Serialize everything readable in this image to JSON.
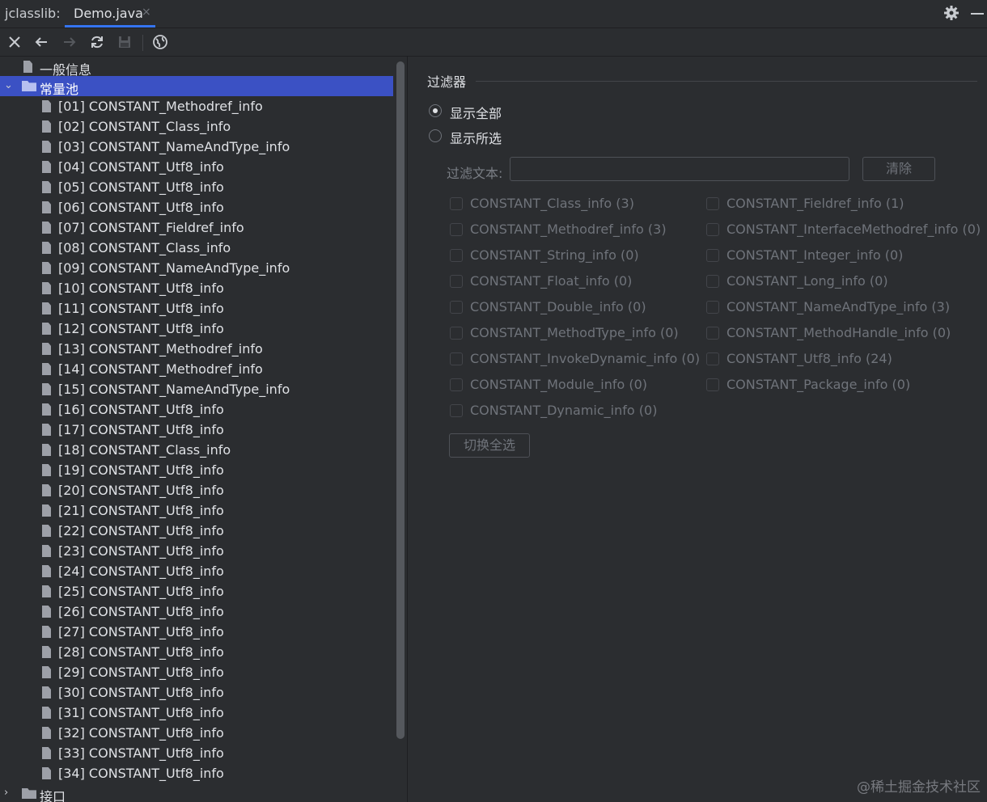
{
  "titlebar": {
    "app_label": "jclasslib:",
    "tab_label": "Demo.java",
    "tab_close": "×",
    "settings_icon": "gear-icon",
    "minimize_icon": "minimize-icon"
  },
  "toolbar": {
    "icons": [
      "close-icon",
      "back-arrow-icon",
      "forward-arrow-icon",
      "refresh-icon",
      "save-icon",
      "browser-icon"
    ]
  },
  "tree": {
    "general_info": "一般信息",
    "constant_pool": "常量池",
    "constant_pool_items": [
      "[01] CONSTANT_Methodref_info",
      "[02] CONSTANT_Class_info",
      "[03] CONSTANT_NameAndType_info",
      "[04] CONSTANT_Utf8_info",
      "[05] CONSTANT_Utf8_info",
      "[06] CONSTANT_Utf8_info",
      "[07] CONSTANT_Fieldref_info",
      "[08] CONSTANT_Class_info",
      "[09] CONSTANT_NameAndType_info",
      "[10] CONSTANT_Utf8_info",
      "[11] CONSTANT_Utf8_info",
      "[12] CONSTANT_Utf8_info",
      "[13] CONSTANT_Methodref_info",
      "[14] CONSTANT_Methodref_info",
      "[15] CONSTANT_NameAndType_info",
      "[16] CONSTANT_Utf8_info",
      "[17] CONSTANT_Utf8_info",
      "[18] CONSTANT_Class_info",
      "[19] CONSTANT_Utf8_info",
      "[20] CONSTANT_Utf8_info",
      "[21] CONSTANT_Utf8_info",
      "[22] CONSTANT_Utf8_info",
      "[23] CONSTANT_Utf8_info",
      "[24] CONSTANT_Utf8_info",
      "[25] CONSTANT_Utf8_info",
      "[26] CONSTANT_Utf8_info",
      "[27] CONSTANT_Utf8_info",
      "[28] CONSTANT_Utf8_info",
      "[29] CONSTANT_Utf8_info",
      "[30] CONSTANT_Utf8_info",
      "[31] CONSTANT_Utf8_info",
      "[32] CONSTANT_Utf8_info",
      "[33] CONSTANT_Utf8_info",
      "[34] CONSTANT_Utf8_info"
    ],
    "interfaces": "接口"
  },
  "filter": {
    "group_title": "过滤器",
    "radio_show_all": "显示全部",
    "radio_show_selected": "显示所选",
    "selected_radio": "show_all",
    "text_label": "过滤文本:",
    "text_value": "",
    "clear_button": "清除",
    "checkboxes_left": [
      "CONSTANT_Class_info (3)",
      "CONSTANT_Methodref_info (3)",
      "CONSTANT_String_info (0)",
      "CONSTANT_Float_info (0)",
      "CONSTANT_Double_info (0)",
      "CONSTANT_MethodType_info (0)",
      "CONSTANT_InvokeDynamic_info (0)",
      "CONSTANT_Module_info (0)",
      "CONSTANT_Dynamic_info (0)"
    ],
    "checkboxes_right": [
      "CONSTANT_Fieldref_info (1)",
      "CONSTANT_InterfaceMethodref_info (0)",
      "CONSTANT_Integer_info (0)",
      "CONSTANT_Long_info (0)",
      "CONSTANT_NameAndType_info (3)",
      "CONSTANT_MethodHandle_info (0)",
      "CONSTANT_Utf8_info (24)",
      "CONSTANT_Package_info (0)"
    ],
    "toggle_all_button": "切换全选"
  },
  "watermark": "@稀土掘金技术社区",
  "colors": {
    "background": "#2b2d30",
    "selection": "#3b51c4",
    "accent": "#3574f0",
    "text": "#dfe1e5",
    "disabled_text": "#6f737a"
  }
}
